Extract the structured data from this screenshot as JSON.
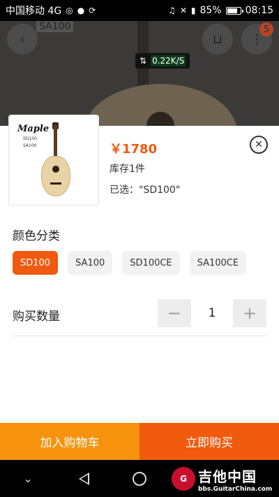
{
  "status_bar": {
    "carrier": "中国移动 4G",
    "battery": "85%",
    "battery_level": 0.85,
    "time": "08:15"
  },
  "background_page": {
    "model_label": "SA100",
    "cart_badge": "5",
    "network_speed": "0.22K/S"
  },
  "product": {
    "price": "￥1780",
    "stock": "库存1件",
    "selected": "已选：\"SD100\"",
    "thumb_text_1": "SD100",
    "thumb_text_2": "SA100",
    "thumb_logo": "Maple"
  },
  "color_section": {
    "title": "颜色分类",
    "options": [
      "SD100",
      "SA100",
      "SD100CE",
      "SA100CE"
    ],
    "selected_index": 0
  },
  "quantity_section": {
    "title": "购买数量",
    "minus": "−",
    "value": "1",
    "plus": "+"
  },
  "actions": {
    "add_to_cart": "加入购物车",
    "buy_now": "立即购买"
  },
  "watermark": {
    "title": "吉他中国",
    "subtitle": "bbs.GuitarChina.com"
  },
  "colors": {
    "accent": "#f05a10",
    "cart_button": "#f7920d",
    "buy_button": "#f15b0e"
  }
}
